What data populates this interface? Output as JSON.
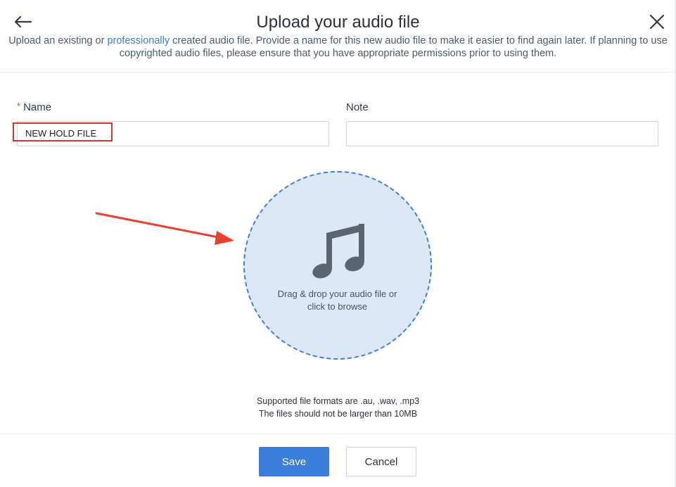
{
  "dialog": {
    "title": "Upload your audio file",
    "subtitle_before_link": "Upload an existing or ",
    "subtitle_link": "professionally",
    "subtitle_after_link": " created audio file. Provide a name for this new audio file to make it easier to find again later. If planning to use copyrighted audio files, please ensure that you have appropriate permissions prior to using them.",
    "back_icon": "arrow-left-icon",
    "close_icon": "close-icon"
  },
  "form": {
    "name": {
      "label": "Name",
      "required_marker": "*",
      "value": "NEW HOLD FILE"
    },
    "note": {
      "label": "Note",
      "value": ""
    }
  },
  "dropzone": {
    "icon": "music-note-icon",
    "text_line1": "Drag & drop your audio file or",
    "text_line2": "click to browse"
  },
  "hints": {
    "formats": "Supported file formats are .au, .wav, .mp3",
    "size_limit": "The files should not be larger than 10MB"
  },
  "footer": {
    "save_label": "Save",
    "cancel_label": "Cancel"
  },
  "colors": {
    "accent": "#3b7ddd",
    "dropzone_fill": "#dce8f6",
    "annotation_red": "#d9352b",
    "required_red": "#e0433a"
  }
}
